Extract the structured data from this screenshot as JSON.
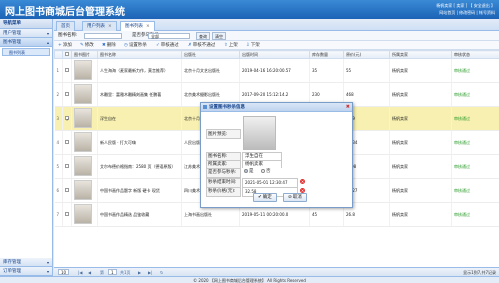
{
  "header": {
    "title": "网上图书商城后台管理系统",
    "user_line1": "杨帆卖家 [ 卖家 ]  【 安全退出 】",
    "user_line2": "网站首页 | 修改密码 | 帐号资料"
  },
  "sidebar": {
    "title": "导航菜单",
    "sections": [
      {
        "label": "用户管理"
      },
      {
        "label": "图书管理"
      }
    ],
    "items": [
      {
        "label": "图书列表"
      }
    ],
    "bottom_sections": [
      {
        "label": "库存管理"
      },
      {
        "label": "订单管理"
      }
    ]
  },
  "tabs": [
    {
      "label": "首页"
    },
    {
      "label": "用户列表"
    },
    {
      "label": "图书列表"
    }
  ],
  "search": {
    "name_label": "图书名称:",
    "seckill_label": "是否参与秒杀:",
    "seckill_value": "全部",
    "search_button": "查询",
    "reset_button": "清空"
  },
  "toolbar": {
    "buttons": [
      {
        "icon": "+",
        "label": "添加"
      },
      {
        "icon": "✎",
        "label": "修改"
      },
      {
        "icon": "✖",
        "label": "删除"
      },
      {
        "icon": "◷",
        "label": "设置秒杀"
      },
      {
        "icon": "✓",
        "label": "审核通过"
      },
      {
        "icon": "✗",
        "label": "审核不通过"
      },
      {
        "icon": "⇧",
        "label": "上架"
      },
      {
        "icon": "⇩",
        "label": "下架"
      }
    ]
  },
  "table": {
    "headers": [
      "",
      "",
      "图书图片",
      "图书名称",
      "出版社",
      "出版时间",
      "库存数量",
      "原价(元)",
      "所属卖家",
      "审核状态"
    ],
    "rows": [
      {
        "num": "1",
        "name": "人生海海（麦家最新力作，莫言推荐）",
        "publisher": "北京十月文艺出版社",
        "date": "2019-04-16 16:20:00.57",
        "stock": "35",
        "price": "55",
        "seller": "杨帆卖家",
        "status": "审核通过"
      },
      {
        "num": "2",
        "name": "木雕里：富雅木雕精刻画集 任鹏著",
        "publisher": "北京美术摄影出版社",
        "date": "2017-09-20 15:12:14.2",
        "stock": "230",
        "price": "468",
        "seller": "杨帆卖家",
        "status": "审核通过"
      },
      {
        "num": "3",
        "name": "浮生自在",
        "publisher": "北京十月文艺出版社",
        "date": "",
        "stock": "",
        "price": "40.9",
        "seller": "杨帆卖家",
        "status": "审核通过"
      },
      {
        "num": "4",
        "name": "新人民版 · 打大可嗨",
        "publisher": "人民出版社",
        "date": "",
        "stock": "",
        "price": "82.34",
        "seller": "杨帆卖家",
        "status": "审核通过"
      },
      {
        "num": "5",
        "name": "艾尔布德价格指南：2580 页（德语原版）",
        "publisher": "江苏美术出版社",
        "date": "",
        "stock": "",
        "price": "1298",
        "seller": "杨帆卖家",
        "status": "审核通过"
      },
      {
        "num": "6",
        "name": "中国书画作品题字 新版 硬卡 现货",
        "publisher": "四川美术出版社",
        "date": "",
        "stock": "",
        "price": "33.27",
        "seller": "杨帆卖家",
        "status": "审核通过"
      },
      {
        "num": "7",
        "name": "中国书画作品精选 品鉴收藏",
        "publisher": "上海书画出版社",
        "date": "2019-05-11 00:20:00.0",
        "stock": "45",
        "price": "26.8",
        "seller": "杨帆卖家",
        "status": "审核通过"
      }
    ]
  },
  "pager": {
    "page_size": "10",
    "page_label": "第",
    "page_value": "1",
    "total_label": "共1页",
    "info": "显示1到7,共7记录"
  },
  "dialog": {
    "title": "设置图书秒杀信息",
    "preview_label": "图片预览:",
    "name_label": "图书名称:",
    "name_value": "浮生自在",
    "seller_label": "所属卖家:",
    "seller_value": "杨帆卖家",
    "seckill_label": "是否参与秒杀:",
    "yes_label": "是",
    "no_label": "否",
    "end_label": "秒杀结束时间:",
    "end_value": "2021-05-01 12:30:47",
    "price_label": "秒杀价格(元):",
    "price_value": "32.58",
    "confirm_label": "确定",
    "cancel_label": "取消"
  },
  "footer": {
    "text": "© 2020 【网上图书商城后台管理系统】 All Rights Reserved"
  }
}
